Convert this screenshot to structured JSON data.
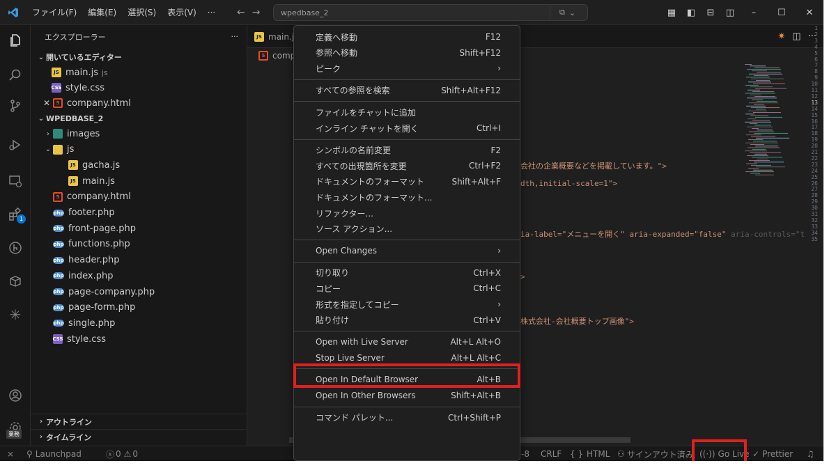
{
  "titlebar": {
    "menu": [
      "ファイル(F)",
      "編集(E)",
      "選択(S)",
      "表示(V)",
      "···"
    ],
    "search_text": "wpedbase_2"
  },
  "sidebar": {
    "title": "エクスプローラー",
    "more": "···",
    "open_editors_label": "開いているエディター",
    "open_editors": [
      {
        "name": "main.js",
        "hint": "js",
        "type": "js"
      },
      {
        "name": "style.css",
        "hint": "",
        "type": "css"
      },
      {
        "name": "company.html",
        "hint": "",
        "type": "html"
      }
    ],
    "workspace_label": "WPEDBASE_2",
    "tree": [
      {
        "name": "images",
        "type": "folder",
        "indent": 1,
        "chev": "›"
      },
      {
        "name": "js",
        "type": "folder-js",
        "indent": 1,
        "chev": "⌄"
      },
      {
        "name": "gacha.js",
        "type": "js",
        "indent": 2,
        "chev": ""
      },
      {
        "name": "main.js",
        "type": "js",
        "indent": 2,
        "chev": ""
      },
      {
        "name": "company.html",
        "type": "html",
        "indent": 1,
        "chev": ""
      },
      {
        "name": "footer.php",
        "type": "php",
        "indent": 1,
        "chev": ""
      },
      {
        "name": "front-page.php",
        "type": "php",
        "indent": 1,
        "chev": ""
      },
      {
        "name": "functions.php",
        "type": "php",
        "indent": 1,
        "chev": ""
      },
      {
        "name": "header.php",
        "type": "php",
        "indent": 1,
        "chev": ""
      },
      {
        "name": "index.php",
        "type": "php",
        "indent": 1,
        "chev": ""
      },
      {
        "name": "page-company.php",
        "type": "php",
        "indent": 1,
        "chev": ""
      },
      {
        "name": "page-form.php",
        "type": "php",
        "indent": 1,
        "chev": ""
      },
      {
        "name": "single.php",
        "type": "php",
        "indent": 1,
        "chev": ""
      },
      {
        "name": "style.css",
        "type": "css",
        "indent": 1,
        "chev": ""
      }
    ],
    "outline_label": "アウトライン",
    "timeline_label": "タイムライン"
  },
  "activity": {
    "extensions_badge": "1",
    "account_badge": "業務"
  },
  "editor": {
    "tab_label": "main.j",
    "breadcrumb_file": "comp",
    "line_numbers": [
      "1",
      "2",
      "3",
      "4",
      "5",
      "6",
      "7",
      "8",
      "9",
      "10",
      "11",
      "12",
      "13",
      "14",
      "15",
      "16",
      "17",
      "18",
      "19",
      "20",
      "21",
      "22",
      "23",
      "24",
      "25",
      "26",
      "27",
      "28",
      "29",
      "30",
      "31",
      "32",
      "33",
      "34",
      "35"
    ],
    "current_line": "13",
    "code_fragments": [
      {
        "line": 7,
        "text": "会社の企業概要などを掲載しています。\">"
      },
      {
        "line": 10,
        "text": "dth,initial-scale=1\">"
      },
      {
        "line": 18,
        "text": "ia-label=\"メニューを開く\" aria-expanded=\"false\"",
        "grey": " aria-controls=\"t"
      },
      {
        "line": 25,
        "text": ">"
      },
      {
        "line": 32,
        "text": "株式会社-会社概要トップ画像\">"
      }
    ]
  },
  "context_menu": {
    "items": [
      {
        "label": "定義へ移動",
        "key": "F12",
        "sub": false
      },
      {
        "label": "参照へ移動",
        "key": "Shift+F12",
        "sub": false
      },
      {
        "label": "ピーク",
        "key": "",
        "sub": true
      },
      {
        "sep": true
      },
      {
        "label": "すべての参照を検索",
        "key": "Shift+Alt+F12",
        "sub": false
      },
      {
        "sep": true
      },
      {
        "label": "ファイルをチャットに追加",
        "key": "",
        "sub": false
      },
      {
        "label": "インライン チャットを開く",
        "key": "Ctrl+I",
        "sub": false
      },
      {
        "sep": true
      },
      {
        "label": "シンボルの名前変更",
        "key": "F2",
        "sub": false
      },
      {
        "label": "すべての出現箇所を変更",
        "key": "Ctrl+F2",
        "sub": false
      },
      {
        "label": "ドキュメントのフォーマット",
        "key": "Shift+Alt+F",
        "sub": false
      },
      {
        "label": "ドキュメントのフォーマット...",
        "key": "",
        "sub": false
      },
      {
        "label": "リファクター...",
        "key": "",
        "sub": false
      },
      {
        "label": "ソース アクション...",
        "key": "",
        "sub": false
      },
      {
        "sep": true
      },
      {
        "label": "Open Changes",
        "key": "",
        "sub": true
      },
      {
        "sep": true
      },
      {
        "label": "切り取り",
        "key": "Ctrl+X",
        "sub": false
      },
      {
        "label": "コピー",
        "key": "Ctrl+C",
        "sub": false
      },
      {
        "label": "形式を指定してコピー",
        "key": "",
        "sub": true
      },
      {
        "label": "貼り付け",
        "key": "Ctrl+V",
        "sub": false
      },
      {
        "sep": true
      },
      {
        "label": "Open with Live Server",
        "key": "Alt+L Alt+O",
        "sub": false
      },
      {
        "label": "Stop Live Server",
        "key": "Alt+L Alt+C",
        "sub": false
      },
      {
        "sep": true
      },
      {
        "label": "Open In Default Browser",
        "key": "Alt+B",
        "sub": false
      },
      {
        "label": "Open In Other Browsers",
        "key": "Shift+Alt+B",
        "sub": false
      },
      {
        "sep": true
      },
      {
        "label": "コマンド パレット...",
        "key": "Ctrl+Shift+P",
        "sub": false
      }
    ]
  },
  "statusbar": {
    "remote": "⨯",
    "launchpad": "Launchpad",
    "errors": "0",
    "warnings": "0",
    "encoding": "-8",
    "eol": "CRLF",
    "braces": "{ }",
    "language": "HTML",
    "signed_out": "サインアウト済み",
    "go_live": "Go Live",
    "prettier": "Prettier"
  },
  "colors": {
    "highlight": "#e02020",
    "accent": "#0078d4"
  }
}
